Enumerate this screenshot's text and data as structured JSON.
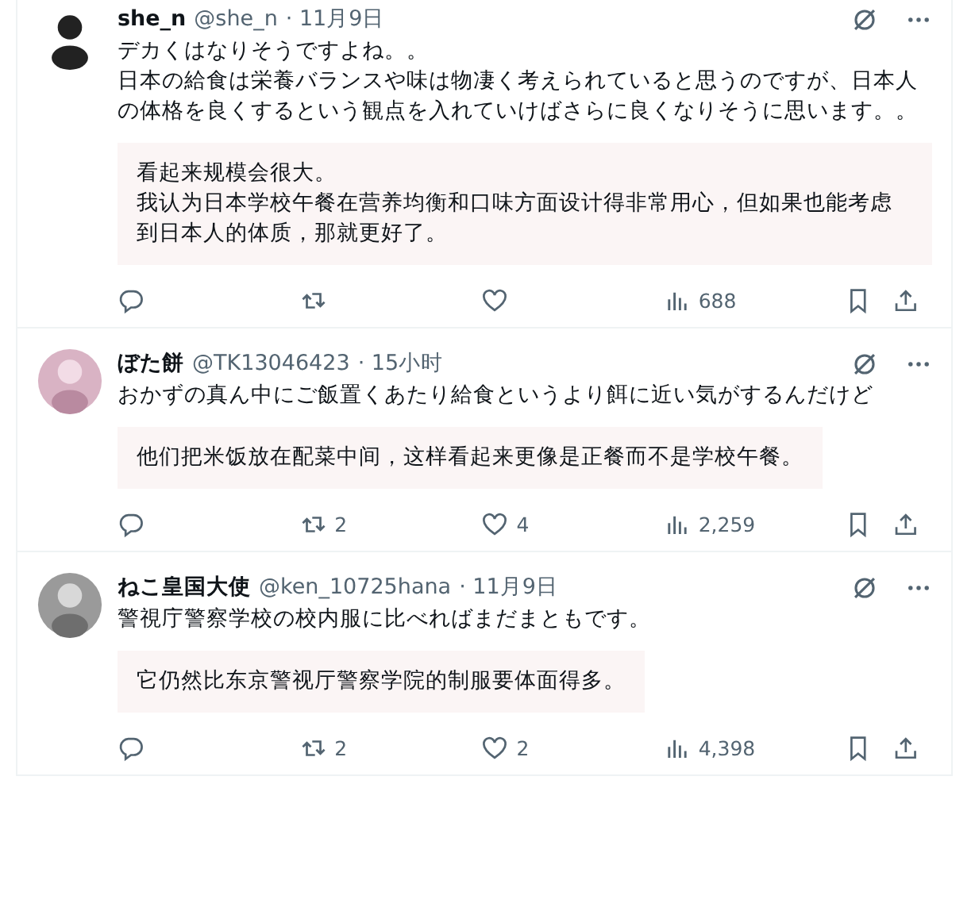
{
  "posts": [
    {
      "name": "she_n",
      "handle": "@she_n",
      "time": "· 11月9日",
      "text": [
        "デカくはなりそうですよね。。",
        "日本の給食は栄養バランスや味は物凄く考えられていると思うのですが、日本人の体格を良くするという観点を入れていけばさらに良くなりそうに思います。。"
      ],
      "translation": [
        "看起来规模会很大。",
        "我认为日本学校午餐在营养均衡和口味方面设计得非常用心，但如果也能考虑到日本人的体质，那就更好了。"
      ],
      "views": "688"
    },
    {
      "name": "ぼた餅",
      "handle": "@TK13046423",
      "time": "· 15小时",
      "text": [
        "おかずの真ん中にご飯置くあたり給食というより餌に近い気がするんだけど"
      ],
      "translation": [
        "他们把米饭放在配菜中间，这样看起来更像是正餐而不是学校午餐。"
      ],
      "reposts": "2",
      "likes": "4",
      "views": "2,259"
    },
    {
      "name": "ねこ皇国大使",
      "handle": "@ken_10725hana",
      "time": "· 11月9日",
      "text": [
        "警視庁警察学校の校内服に比べればまだまともです。"
      ],
      "translation": [
        "它仍然比东京警视厅警察学院的制服要体面得多。"
      ],
      "reposts": "2",
      "likes": "2",
      "views": "4,398"
    }
  ]
}
